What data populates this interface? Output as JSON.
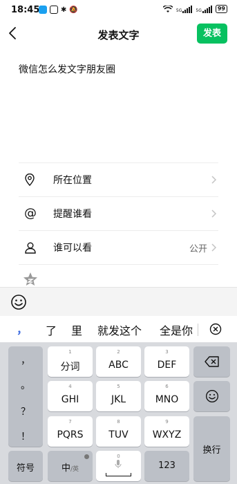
{
  "status_bar": {
    "time": "18:45",
    "network_left": "5G",
    "network_right": "5G",
    "battery": "99"
  },
  "header": {
    "title": "发表文字",
    "publish_label": "发表"
  },
  "post": {
    "text": "微信怎么发文字朋友圈"
  },
  "options": {
    "location": {
      "label": "所在位置",
      "icon": "location-pin-icon"
    },
    "remind": {
      "label": "提醒谁看",
      "icon": "at-icon"
    },
    "visibility": {
      "label": "谁可以看",
      "value": "公开",
      "icon": "person-icon"
    }
  },
  "candidates": {
    "comma": "，",
    "items": [
      "了",
      "里",
      "就发这个",
      "全是你"
    ]
  },
  "keyboard": {
    "symbols": [
      "，",
      "。",
      "？",
      "！"
    ],
    "keys": [
      {
        "sub": "1",
        "label": "分词"
      },
      {
        "sub": "2",
        "label": "ABC"
      },
      {
        "sub": "3",
        "label": "DEF"
      },
      {
        "sub": "4",
        "label": "GHI"
      },
      {
        "sub": "5",
        "label": "JKL"
      },
      {
        "sub": "6",
        "label": "MNO"
      },
      {
        "sub": "7",
        "label": "PQRS"
      },
      {
        "sub": "8",
        "label": "TUV"
      },
      {
        "sub": "9",
        "label": "WXYZ"
      }
    ],
    "symbol_key": "符号",
    "lang_key_main": "中",
    "lang_key_sub": "/英",
    "space_sub": "0",
    "num_key": "123",
    "enter_key": "换行"
  },
  "colors": {
    "accent_green": "#07c160",
    "candidate_blue": "#3d6be0",
    "keyboard_bg": "#d8dade"
  }
}
